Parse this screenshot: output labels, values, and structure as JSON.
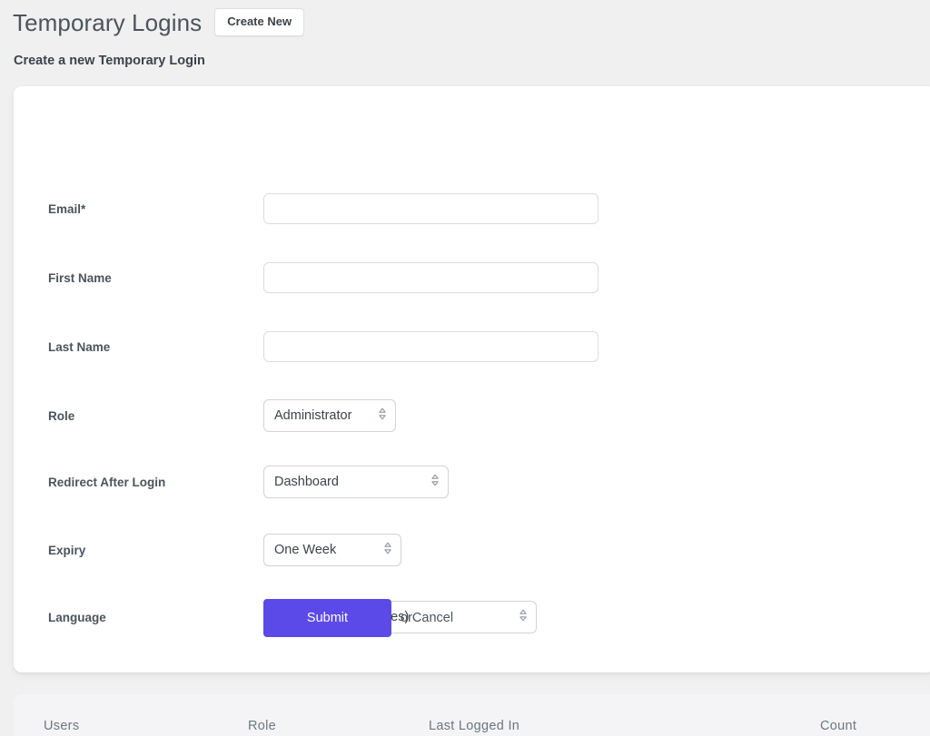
{
  "header": {
    "title": "Temporary Logins",
    "create_new_label": "Create New",
    "subtitle": "Create a new Temporary Login"
  },
  "form": {
    "fields": [
      {
        "label": "Email*",
        "type": "text",
        "value": "",
        "placeholder": "",
        "name": "email"
      },
      {
        "label": "First Name",
        "type": "text",
        "value": "",
        "placeholder": "",
        "name": "first-name"
      },
      {
        "label": "Last Name",
        "type": "text",
        "value": "",
        "placeholder": "",
        "name": "last-name"
      },
      {
        "label": "Role",
        "type": "select",
        "value": "Administrator",
        "name": "role"
      },
      {
        "label": "Redirect After Login",
        "type": "select",
        "value": "Dashboard",
        "name": "redirect-after-login"
      },
      {
        "label": "Expiry",
        "type": "select",
        "value": "One Week",
        "name": "expiry"
      },
      {
        "label": "Language",
        "type": "select",
        "value": "English (United States)",
        "name": "language"
      }
    ],
    "submit_label": "Submit",
    "or_text": "or ",
    "cancel_label": "Cancel"
  },
  "table": {
    "columns": [
      "Users",
      "Role",
      "Last Logged In",
      "Count"
    ],
    "rows": []
  },
  "colors": {
    "page_background": "#f0f0f1",
    "card_background": "#ffffff",
    "accent": "#5b4ae8",
    "text": "#3c434a",
    "muted_text": "#6c7781",
    "border": "#dcdce0",
    "table_panel": "#f4f4f6"
  },
  "icons": {
    "stepper": "stepper-updown-icon"
  }
}
